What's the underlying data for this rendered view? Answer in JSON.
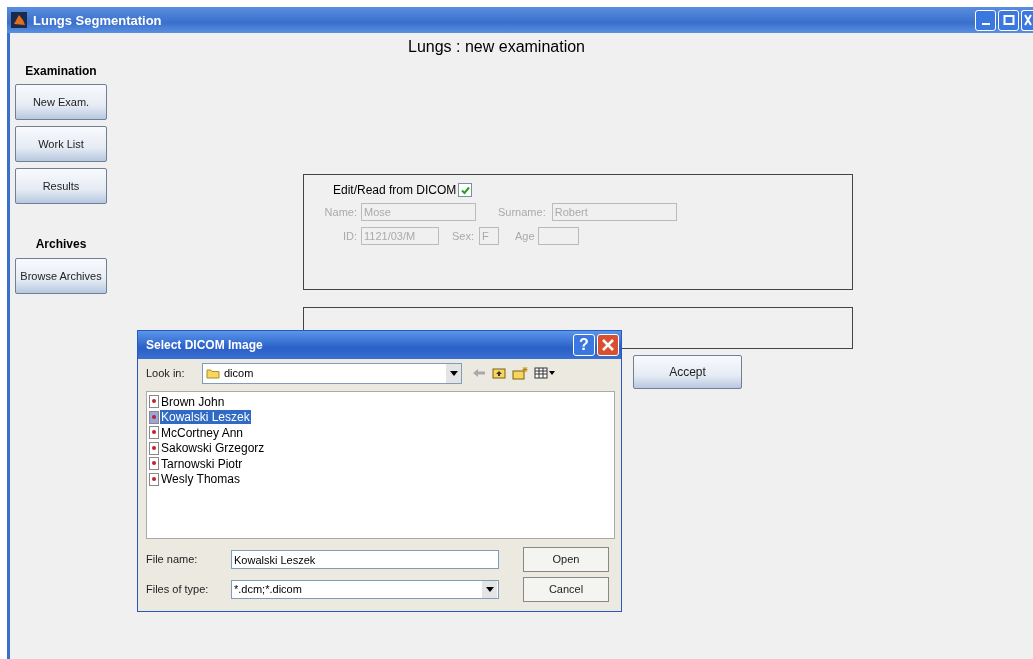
{
  "window": {
    "title": "Lungs Segmentation"
  },
  "sidebar": {
    "sections": [
      {
        "heading": "Examination",
        "buttons": [
          "New Exam.",
          "Work List",
          "Results"
        ]
      },
      {
        "heading": "Archives",
        "buttons": [
          "Browse Archives"
        ]
      }
    ]
  },
  "page_title": "Lungs : new examination",
  "patient_panel": {
    "dicom_label": "Edit/Read from DICOM",
    "dicom_checked": true,
    "name_label": "Name:",
    "name": "Mose",
    "surname_label": "Surname:",
    "surname": "Robert",
    "id_label": "ID:",
    "id": "1121/03/M",
    "sex_label": "Sex:",
    "sex": "F",
    "age_label": "Age"
  },
  "accept_button": "Accept",
  "dialog": {
    "title": "Select DICOM Image",
    "help": "?",
    "look_in_label": "Look in:",
    "look_in": "dicom",
    "files": [
      {
        "name": "Brown John",
        "selected": false
      },
      {
        "name": "Kowalski Leszek",
        "selected": true
      },
      {
        "name": "McCortney Ann",
        "selected": false
      },
      {
        "name": "Sakowski Grzegorz",
        "selected": false
      },
      {
        "name": "Tarnowski Piotr",
        "selected": false
      },
      {
        "name": "Wesly Thomas",
        "selected": false
      }
    ],
    "file_name_label": "File name:",
    "file_name": "Kowalski Leszek",
    "file_type_label": "Files of type:",
    "file_type": "*.dcm;*.dicom",
    "open_button": "Open",
    "cancel_button": "Cancel"
  }
}
